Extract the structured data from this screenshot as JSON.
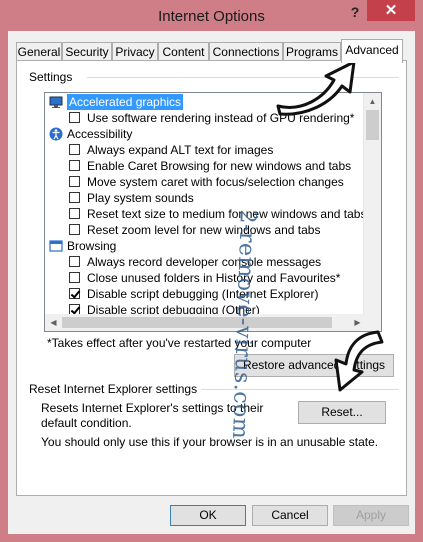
{
  "window": {
    "title": "Internet Options",
    "help": "?",
    "close": "✕"
  },
  "tabs": [
    {
      "label": "General"
    },
    {
      "label": "Security"
    },
    {
      "label": "Privacy"
    },
    {
      "label": "Content"
    },
    {
      "label": "Connections"
    },
    {
      "label": "Programs"
    },
    {
      "label": "Advanced"
    }
  ],
  "settings": {
    "group_label": "Settings",
    "items": [
      {
        "label": "Accelerated graphics",
        "type": "category",
        "icon": "monitor-icon",
        "selected": true
      },
      {
        "label": "Use software rendering instead of GPU rendering*",
        "type": "checkbox",
        "checked": false
      },
      {
        "label": "Accessibility",
        "type": "category",
        "icon": "accessibility-icon"
      },
      {
        "label": "Always expand ALT text for images",
        "type": "checkbox",
        "checked": false
      },
      {
        "label": "Enable Caret Browsing for new windows and tabs",
        "type": "checkbox",
        "checked": false
      },
      {
        "label": "Move system caret with focus/selection changes",
        "type": "checkbox",
        "checked": false
      },
      {
        "label": "Play system sounds",
        "type": "checkbox",
        "checked": false
      },
      {
        "label": "Reset text size to medium for new windows and tabs",
        "type": "checkbox",
        "checked": false
      },
      {
        "label": "Reset zoom level for new windows and tabs",
        "type": "checkbox",
        "checked": false
      },
      {
        "label": "Browsing",
        "type": "category",
        "icon": "browsing-icon"
      },
      {
        "label": "Always record developer console messages",
        "type": "checkbox",
        "checked": false
      },
      {
        "label": "Close unused folders in History and Favourites*",
        "type": "checkbox",
        "checked": false
      },
      {
        "label": "Disable script debugging (Internet Explorer)",
        "type": "checkbox",
        "checked": true
      },
      {
        "label": "Disable script debugging (Other)",
        "type": "checkbox",
        "checked": true
      }
    ],
    "footnote": "*Takes effect after you've restarted your computer",
    "restore_button": "Restore advanced settings"
  },
  "reset": {
    "group_label": "Reset Internet Explorer settings",
    "description": "Resets Internet Explorer's settings to their default condition.",
    "button": "Reset...",
    "note": "You should only use this if your browser is in an unusable state."
  },
  "footer": {
    "ok": "OK",
    "cancel": "Cancel",
    "apply": "Apply"
  },
  "watermark": "2-remove-virus.com"
}
